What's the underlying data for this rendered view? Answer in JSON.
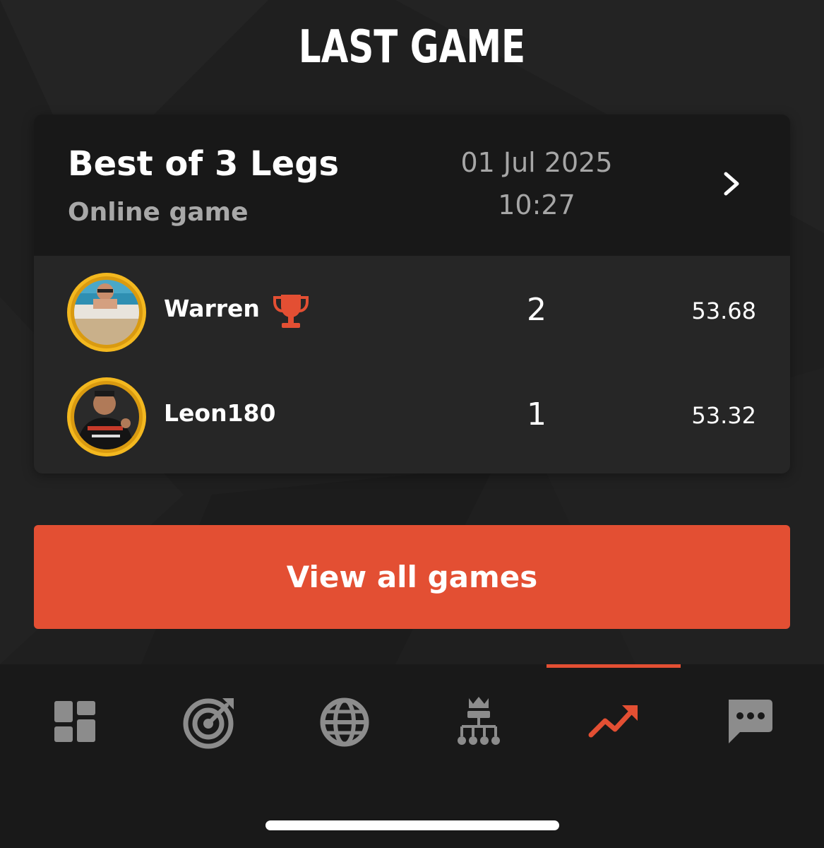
{
  "header": {
    "title": "LAST GAME"
  },
  "last_game": {
    "name": "Best of 3 Legs",
    "type": "Online game",
    "date": "01 Jul 2025",
    "time": "10:27",
    "players": [
      {
        "name": "Warren",
        "legs": "2",
        "average": "53.68",
        "winner": true
      },
      {
        "name": "Leon180",
        "legs": "1",
        "average": "53.32",
        "winner": false
      }
    ]
  },
  "view_all_button": {
    "label": "View all games"
  },
  "bottom_nav": {
    "active": "stats",
    "items": [
      {
        "icon": "dashboard-icon"
      },
      {
        "icon": "target-icon"
      },
      {
        "icon": "globe-icon"
      },
      {
        "icon": "tournament-icon"
      },
      {
        "icon": "trending-up-icon"
      },
      {
        "icon": "chat-icon"
      }
    ]
  },
  "colors": {
    "accent": "#e34f33",
    "background": "#1f1f1f",
    "card_header": "#181818",
    "card_body": "#262626",
    "muted_text": "#a8a8a8",
    "icon_inactive": "#8c8c8c",
    "avatar_ring": "#f3b81f"
  }
}
